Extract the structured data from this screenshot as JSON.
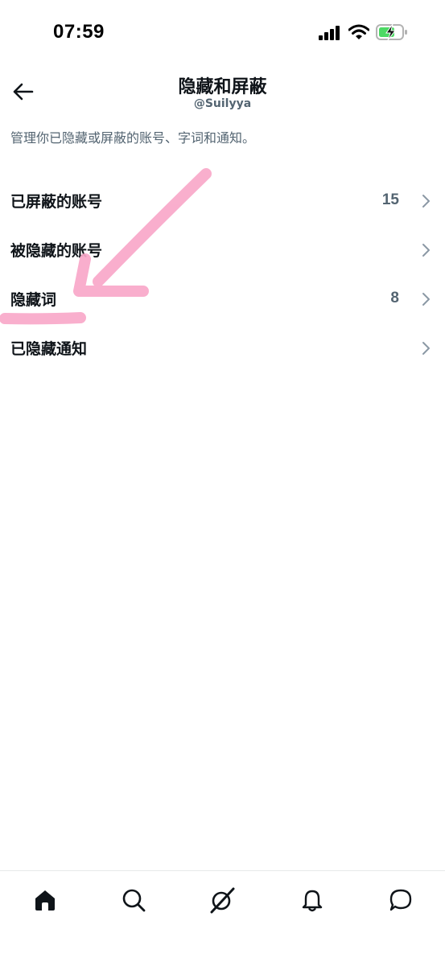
{
  "status_bar": {
    "time": "07:59"
  },
  "header": {
    "title": "隐藏和屏蔽",
    "subtitle": "@Suilyya"
  },
  "description": "管理你已隐藏或屏蔽的账号、字词和通知。",
  "menu": [
    {
      "label": "已屏蔽的账号",
      "count": "15"
    },
    {
      "label": "被隐藏的账号",
      "count": ""
    },
    {
      "label": "隐藏词",
      "count": "8"
    },
    {
      "label": "已隐藏通知",
      "count": ""
    }
  ],
  "tab_bar": {
    "tabs": [
      "home-icon",
      "search-icon",
      "grok-icon",
      "notifications-icon",
      "messages-icon"
    ]
  },
  "colors": {
    "text_primary": "#0f1419",
    "text_secondary": "#536471",
    "annotation_pink": "#f9a8c9",
    "battery_green": "#4cd964"
  }
}
